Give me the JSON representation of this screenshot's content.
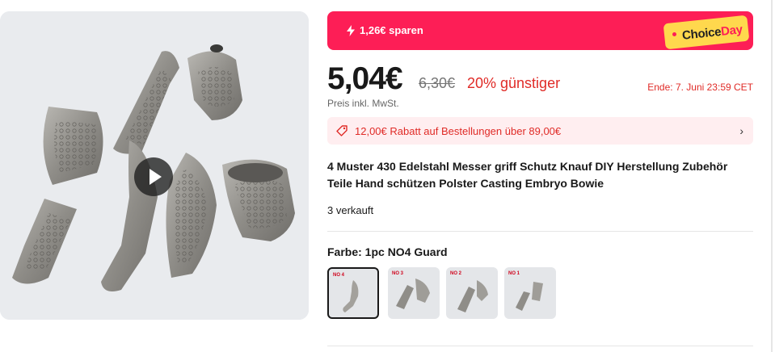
{
  "banner": {
    "savings": "1,26€ sparen",
    "promo_word_1": "Choice",
    "promo_word_2": "Day"
  },
  "price": {
    "current": "5,04€",
    "original": "6,30€",
    "discount": "20% günstiger",
    "ends": "Ende: 7. Juni 23:59 CET",
    "tax_note": "Preis inkl. MwSt."
  },
  "coupon": {
    "text": "12,00€ Rabatt auf Bestellungen über 89,00€"
  },
  "product": {
    "title": "4 Muster 430 Edelstahl Messer griff Schutz Knauf DIY Herstellung Zubehör Teile Hand schützen Polster Casting Embryo Bowie",
    "sold": "3 verkauft"
  },
  "color": {
    "label": "Farbe: 1pc NO4 Guard",
    "options": [
      {
        "label": "NO 4",
        "selected": true
      },
      {
        "label": "NO 3",
        "selected": false
      },
      {
        "label": "NO 2",
        "selected": false
      },
      {
        "label": "NO 1",
        "selected": false
      }
    ]
  },
  "colors": {
    "brand": "#fd1e56",
    "accent_red": "#e02b27",
    "choice_yellow": "#ffd84d"
  },
  "icons": {
    "savings": "lightning-icon",
    "coupon": "tag-icon",
    "coupon_chevron": "chevron-right-icon",
    "video": "play-icon"
  }
}
